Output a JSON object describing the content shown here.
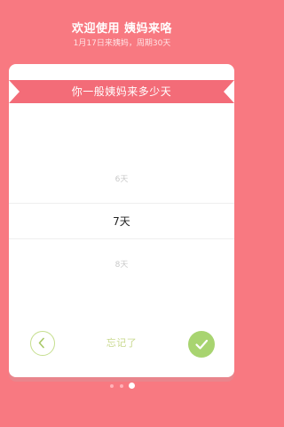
{
  "header": {
    "title": "欢迎使用 姨妈来咯",
    "subtitle": "1月17日来姨妈，周期30天"
  },
  "card": {
    "question": "你一般姨妈来多少天",
    "picker": {
      "previous": "6天",
      "selected": "7天",
      "next": "8天"
    },
    "back_icon": "chevron-left-icon",
    "forgot_label": "忘记了",
    "confirm_icon": "check-icon"
  },
  "pagination": {
    "total": 3,
    "current": 3
  },
  "colors": {
    "background": "#f87981",
    "ribbon": "#f36c78",
    "accent_green": "#a8d470",
    "outline_green": "#c6df8f",
    "forgot_text": "#c9d98f"
  }
}
